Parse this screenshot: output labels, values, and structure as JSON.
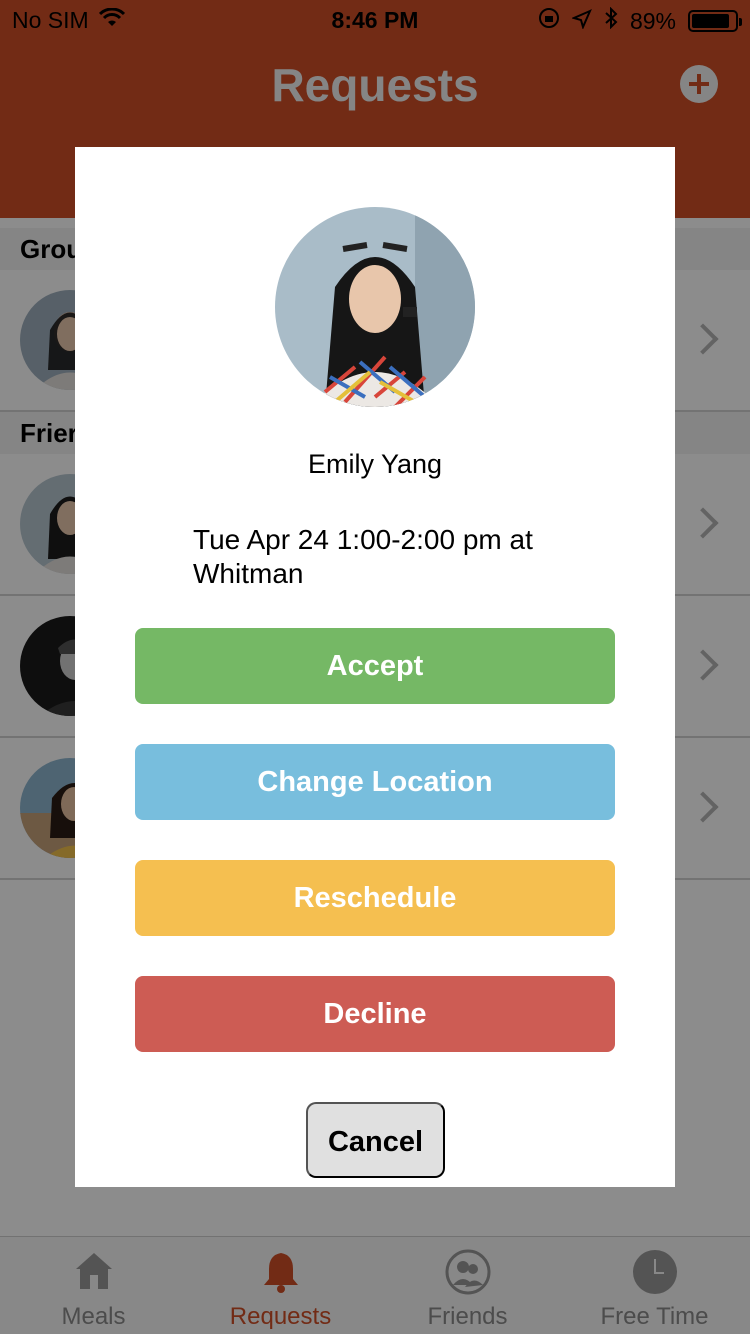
{
  "status_bar": {
    "carrier": "No SIM",
    "time": "8:46 PM",
    "battery_percent": "89%",
    "battery_level": 0.89,
    "icons": [
      "wifi-icon",
      "orientation-lock-icon",
      "location-icon",
      "bluetooth-icon"
    ]
  },
  "header": {
    "title": "Requests",
    "add_icon": "plus-circle-icon",
    "color": "#d04f27"
  },
  "sections": {
    "group": {
      "label": "Grou"
    },
    "friends": {
      "label": "Frier"
    }
  },
  "tab_bar": {
    "tabs": [
      {
        "label": "Meals",
        "icon": "house-icon",
        "active": false
      },
      {
        "label": "Requests",
        "icon": "bell-icon",
        "active": true
      },
      {
        "label": "Friends",
        "icon": "people-icon",
        "active": false
      },
      {
        "label": "Free Time",
        "icon": "clock-icon",
        "active": false
      }
    ]
  },
  "modal": {
    "avatar_icon": "profile-photo",
    "name": "Emily Yang",
    "details": "Tue Apr 24 1:00-2:00 pm at Whitman",
    "buttons": {
      "accept": {
        "label": "Accept",
        "color": "#75b865"
      },
      "change_location": {
        "label": "Change Location",
        "color": "#78bedd"
      },
      "reschedule": {
        "label": "Reschedule",
        "color": "#f5bf50"
      },
      "decline": {
        "label": "Decline",
        "color": "#cd5c54"
      }
    },
    "cancel": {
      "label": "Cancel"
    }
  }
}
